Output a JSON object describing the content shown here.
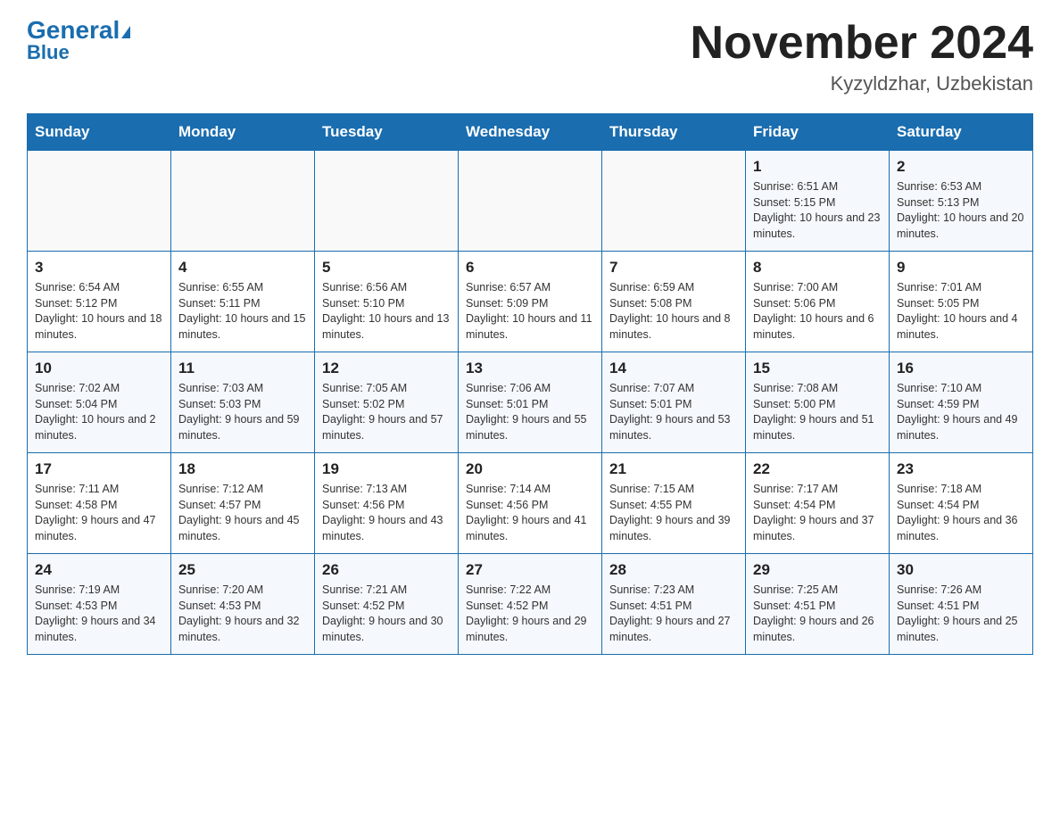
{
  "header": {
    "logo_general": "General",
    "logo_blue": "Blue",
    "month_title": "November 2024",
    "location": "Kyzyldzhar, Uzbekistan"
  },
  "weekdays": [
    "Sunday",
    "Monday",
    "Tuesday",
    "Wednesday",
    "Thursday",
    "Friday",
    "Saturday"
  ],
  "weeks": [
    [
      {
        "day": "",
        "info": ""
      },
      {
        "day": "",
        "info": ""
      },
      {
        "day": "",
        "info": ""
      },
      {
        "day": "",
        "info": ""
      },
      {
        "day": "",
        "info": ""
      },
      {
        "day": "1",
        "info": "Sunrise: 6:51 AM\nSunset: 5:15 PM\nDaylight: 10 hours and 23 minutes."
      },
      {
        "day": "2",
        "info": "Sunrise: 6:53 AM\nSunset: 5:13 PM\nDaylight: 10 hours and 20 minutes."
      }
    ],
    [
      {
        "day": "3",
        "info": "Sunrise: 6:54 AM\nSunset: 5:12 PM\nDaylight: 10 hours and 18 minutes."
      },
      {
        "day": "4",
        "info": "Sunrise: 6:55 AM\nSunset: 5:11 PM\nDaylight: 10 hours and 15 minutes."
      },
      {
        "day": "5",
        "info": "Sunrise: 6:56 AM\nSunset: 5:10 PM\nDaylight: 10 hours and 13 minutes."
      },
      {
        "day": "6",
        "info": "Sunrise: 6:57 AM\nSunset: 5:09 PM\nDaylight: 10 hours and 11 minutes."
      },
      {
        "day": "7",
        "info": "Sunrise: 6:59 AM\nSunset: 5:08 PM\nDaylight: 10 hours and 8 minutes."
      },
      {
        "day": "8",
        "info": "Sunrise: 7:00 AM\nSunset: 5:06 PM\nDaylight: 10 hours and 6 minutes."
      },
      {
        "day": "9",
        "info": "Sunrise: 7:01 AM\nSunset: 5:05 PM\nDaylight: 10 hours and 4 minutes."
      }
    ],
    [
      {
        "day": "10",
        "info": "Sunrise: 7:02 AM\nSunset: 5:04 PM\nDaylight: 10 hours and 2 minutes."
      },
      {
        "day": "11",
        "info": "Sunrise: 7:03 AM\nSunset: 5:03 PM\nDaylight: 9 hours and 59 minutes."
      },
      {
        "day": "12",
        "info": "Sunrise: 7:05 AM\nSunset: 5:02 PM\nDaylight: 9 hours and 57 minutes."
      },
      {
        "day": "13",
        "info": "Sunrise: 7:06 AM\nSunset: 5:01 PM\nDaylight: 9 hours and 55 minutes."
      },
      {
        "day": "14",
        "info": "Sunrise: 7:07 AM\nSunset: 5:01 PM\nDaylight: 9 hours and 53 minutes."
      },
      {
        "day": "15",
        "info": "Sunrise: 7:08 AM\nSunset: 5:00 PM\nDaylight: 9 hours and 51 minutes."
      },
      {
        "day": "16",
        "info": "Sunrise: 7:10 AM\nSunset: 4:59 PM\nDaylight: 9 hours and 49 minutes."
      }
    ],
    [
      {
        "day": "17",
        "info": "Sunrise: 7:11 AM\nSunset: 4:58 PM\nDaylight: 9 hours and 47 minutes."
      },
      {
        "day": "18",
        "info": "Sunrise: 7:12 AM\nSunset: 4:57 PM\nDaylight: 9 hours and 45 minutes."
      },
      {
        "day": "19",
        "info": "Sunrise: 7:13 AM\nSunset: 4:56 PM\nDaylight: 9 hours and 43 minutes."
      },
      {
        "day": "20",
        "info": "Sunrise: 7:14 AM\nSunset: 4:56 PM\nDaylight: 9 hours and 41 minutes."
      },
      {
        "day": "21",
        "info": "Sunrise: 7:15 AM\nSunset: 4:55 PM\nDaylight: 9 hours and 39 minutes."
      },
      {
        "day": "22",
        "info": "Sunrise: 7:17 AM\nSunset: 4:54 PM\nDaylight: 9 hours and 37 minutes."
      },
      {
        "day": "23",
        "info": "Sunrise: 7:18 AM\nSunset: 4:54 PM\nDaylight: 9 hours and 36 minutes."
      }
    ],
    [
      {
        "day": "24",
        "info": "Sunrise: 7:19 AM\nSunset: 4:53 PM\nDaylight: 9 hours and 34 minutes."
      },
      {
        "day": "25",
        "info": "Sunrise: 7:20 AM\nSunset: 4:53 PM\nDaylight: 9 hours and 32 minutes."
      },
      {
        "day": "26",
        "info": "Sunrise: 7:21 AM\nSunset: 4:52 PM\nDaylight: 9 hours and 30 minutes."
      },
      {
        "day": "27",
        "info": "Sunrise: 7:22 AM\nSunset: 4:52 PM\nDaylight: 9 hours and 29 minutes."
      },
      {
        "day": "28",
        "info": "Sunrise: 7:23 AM\nSunset: 4:51 PM\nDaylight: 9 hours and 27 minutes."
      },
      {
        "day": "29",
        "info": "Sunrise: 7:25 AM\nSunset: 4:51 PM\nDaylight: 9 hours and 26 minutes."
      },
      {
        "day": "30",
        "info": "Sunrise: 7:26 AM\nSunset: 4:51 PM\nDaylight: 9 hours and 25 minutes."
      }
    ]
  ]
}
